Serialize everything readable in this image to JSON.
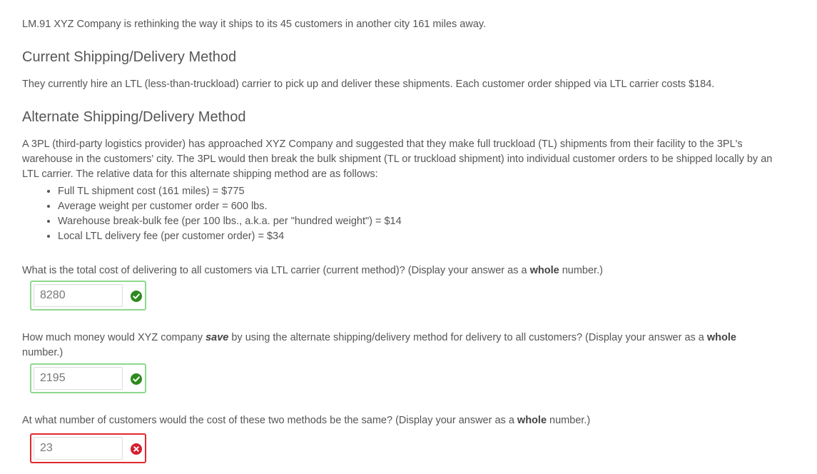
{
  "problem": {
    "intro": "LM.91 XYZ Company is rethinking the way it ships to its 45 customers in another city 161 miles away.",
    "current_heading": "Current Shipping/Delivery Method",
    "current_text": "They currently hire an LTL (less-than-truckload) carrier to pick up and deliver these shipments. Each customer order shipped via LTL carrier costs $184.",
    "alt_heading": "Alternate Shipping/Delivery Method",
    "alt_text": "A 3PL (third-party logistics provider) has approached XYZ Company and suggested that they make full truckload (TL) shipments from their facility to the 3PL's warehouse in the customers' city. The 3PL would then break the bulk shipment (TL or truckload shipment) into individual customer orders to be shipped locally by an LTL carrier. The relative data for this alternate shipping method are as follows:",
    "bullets": [
      "Full TL shipment cost (161 miles) = $775",
      "Average weight per customer order = 600 lbs.",
      "Warehouse break-bulk fee (per 100 lbs., a.k.a. per \"hundred weight\") = $14",
      "Local LTL delivery fee (per customer order) = $34"
    ]
  },
  "questions": [
    {
      "text_before": "What is the total cost of delivering to all customers via LTL carrier (current method)? (Display your answer as a ",
      "bold": "whole",
      "text_after": " number.)",
      "answer": "8280",
      "status": "correct"
    },
    {
      "text_before": "How much money would XYZ company ",
      "emph": "save",
      "text_middle": " by using the alternate shipping/delivery method for delivery to all customers? (Display your answer as a ",
      "bold": "whole",
      "text_after": " number.)",
      "answer": "2195",
      "status": "correct"
    },
    {
      "text_before": "At what number of customers would the cost of these two methods be the same? (Display your answer as a ",
      "bold": "whole",
      "text_after": " number.)",
      "answer": "23",
      "status": "incorrect"
    }
  ],
  "colors": {
    "correct_border": "#8fd88f",
    "correct_icon": "#2e8b1e",
    "incorrect_border": "#e0282e",
    "incorrect_icon": "#d32030"
  },
  "icons": {
    "correct": "check-circle-icon",
    "incorrect": "x-circle-icon"
  }
}
